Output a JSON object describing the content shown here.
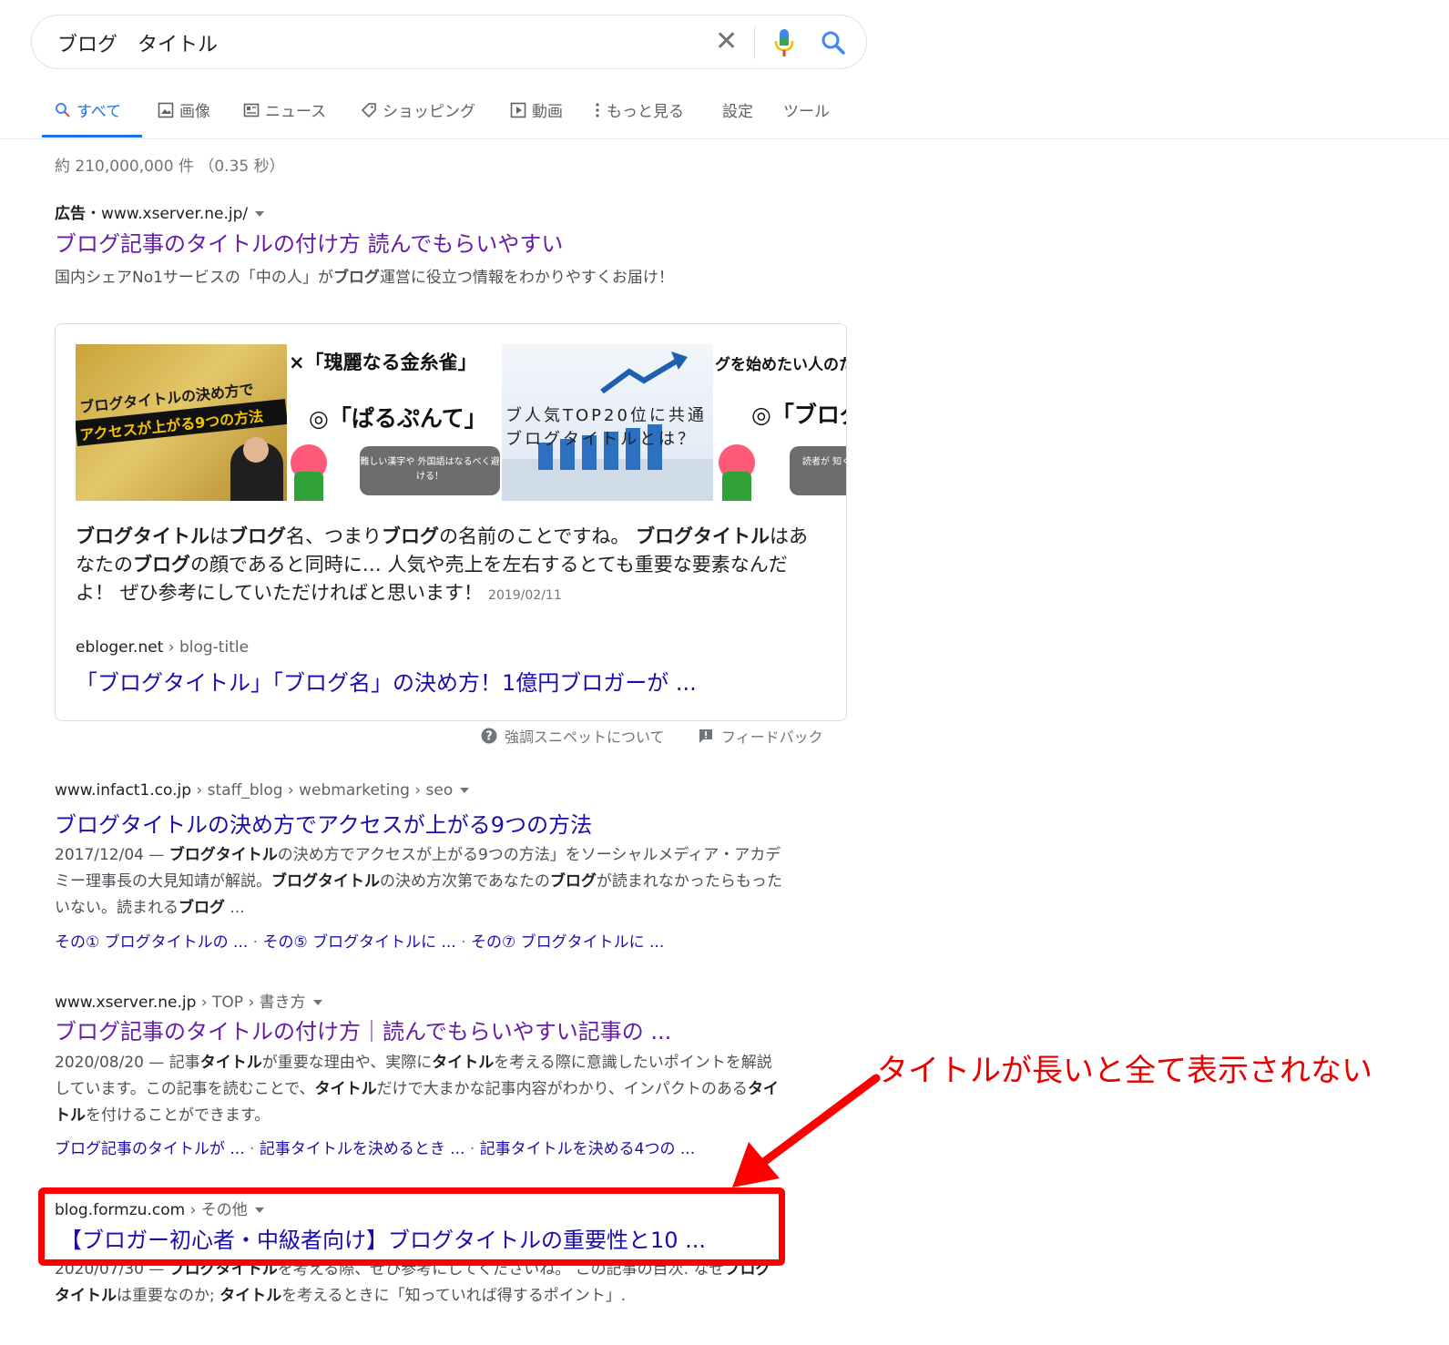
{
  "search": {
    "query": "ブログ　タイトル"
  },
  "tabs": {
    "all": "すべて",
    "images": "画像",
    "news": "ニュース",
    "shopping": "ショッピング",
    "videos": "動画",
    "more": "もっと見る",
    "settings": "設定",
    "tools": "ツール"
  },
  "stats": "約 210,000,000 件 （0.35 秒）",
  "ad": {
    "label": "広告",
    "separator": "・",
    "url": "www.xserver.ne.jp/",
    "title": "ブログ記事のタイトルの付け方 読んでもらいやすい",
    "desc_pre": "国内シェアNo1サービスの「中の人」が",
    "desc_bold": "ブログ",
    "desc_post": "運営に役立つ情報をわかりやすくお届け！"
  },
  "snippet": {
    "thumb1_line1": "ブログタイトルの決め方で",
    "thumb1_line2": "アクセスが上がる9つの方法",
    "thumb2_bad": "×「瑰麗なる金糸雀」",
    "thumb2_good": "◎「ぱるぷんて」",
    "thumb2_bubble": "難しい漢字や 外国語はなるべく避ける！",
    "thumb3_line1": "ブ人気TOP20位に共通",
    "thumb3_line2": "ブログタイトルとは？",
    "thumb4_top": "グを始めたい人のた",
    "thumb4_good": "◎「ブログ",
    "thumb4_bubble": "読者が 知く、",
    "t1b": "ブログタイトル",
    "t2": "は",
    "t3b": "ブログ",
    "t4": "名、つまり",
    "t5b": "ブログ",
    "t6": "の名前のことですね。 ",
    "t7b": "ブログタイトル",
    "t8": "はあなたの",
    "t9b": "ブログ",
    "t10": "の顔であると同時に… 人気や売上を左右するとても重要な要素なんだよ！ ぜひ参考にしていただければと思います！",
    "date": "2019/02/11",
    "domain": "ebloger.net",
    "path": " › blog-title",
    "link": "「ブログタイトル」「ブログ名」の決め方！1億円ブロガーが ..."
  },
  "about": {
    "featured": "強調スニペットについて",
    "feedback": "フィードバック"
  },
  "result1": {
    "domain": "www.infact1.co.jp",
    "path": " › staff_blog › webmarketing › seo",
    "title": "ブログタイトルの決め方でアクセスが上がる9つの方法",
    "d1": "2017/12/04 — ",
    "d2b": "ブログタイトル",
    "d3": "の決め方でアクセスが上がる9つの方法」をソーシャルメディア・アカデミー理事長の大見知靖が解説。",
    "d4b": "ブログタイトル",
    "d5": "の決め方次第であなたの",
    "d6b": "ブログ",
    "d7": "が読まれなかったらもったいない。読まれる",
    "d8b": "ブログ",
    "d9": " ...",
    "s1": "その① ブログタイトルの ...",
    "s2": "その⑤ ブログタイトルに ...",
    "s3": "その⑦ ブログタイトルに ...",
    "sep": " · "
  },
  "result2": {
    "domain": "www.xserver.ne.jp",
    "path": " › TOP › 書き方",
    "title": "ブログ記事のタイトルの付け方｜読んでもらいやすい記事の ...",
    "d1": "2020/08/20 — 記事",
    "d2b": "タイトル",
    "d3": "が重要な理由や、実際に",
    "d4b": "タイトル",
    "d5": "を考える際に意識したいポイントを解説しています。この記事を読むことで、",
    "d6b": "タイトル",
    "d7": "だけで大まかな記事内容がわかり、インパクトのある",
    "d8b": "タイトル",
    "d9": "を付けることができます。",
    "s1": "ブログ記事のタイトルが ...",
    "s2": "記事タイトルを決めるとき ...",
    "s3": "記事タイトルを決める4つの ...",
    "sep": " · "
  },
  "result3": {
    "domain": "blog.formzu.com",
    "path": " › その他",
    "title": "【ブロガー初心者・中級者向け】ブログタイトルの重要性と10 ...",
    "d1": "2020/07/30 — ",
    "d2b": "ブログタイトル",
    "d3": "を考える際、ぜひ参考にしてくださいね。 この記事の目次. なぜ",
    "d4b": "ブログタイトル",
    "d5": "は重要なのか; ",
    "d6b": "タイトル",
    "d7": "を考えるときに「知っていれば得するポイント」."
  },
  "annotation": "タイトルが長いと全て表示されない",
  "colors": {
    "link": "#1a0dab",
    "visited": "#681da8",
    "accent": "#1a73e8",
    "annotation": "#e60000"
  }
}
